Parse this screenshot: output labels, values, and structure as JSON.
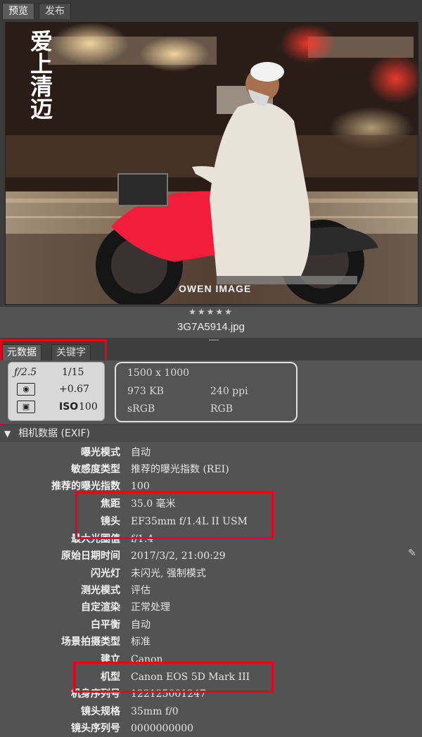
{
  "tabs": [
    "预览",
    "发布"
  ],
  "preview": {
    "watermark_chinese": "爱上清迈",
    "watermark_logo": "OWEN IMAGE",
    "rating": "★★★★★",
    "filename": "3G7A5914.jpg"
  },
  "meta_tabs": [
    "元数据",
    "关键字"
  ],
  "camera": {
    "aperture": "ƒ/2.5",
    "shutter": "1/15",
    "exposure_comp": "+0.67",
    "iso_label": "ISO",
    "iso": "100"
  },
  "file": {
    "dimensions": "1500 x 1000",
    "size": "973 KB",
    "resolution": "240 ppi",
    "color_profile": "sRGB",
    "color_mode": "RGB"
  },
  "section_title": "相机数据 (EXIF)",
  "exif": [
    {
      "key": "曝光模式",
      "value": "自动"
    },
    {
      "key": "敏感度类型",
      "value": "推荐的曝光指数 (REI)"
    },
    {
      "key": "推荐的曝光指数",
      "value": "100"
    },
    {
      "key": "焦距",
      "value": "35.0 毫米"
    },
    {
      "key": "镜头",
      "value": "EF35mm f/1.4L II USM"
    },
    {
      "key": "最大光圈值",
      "value": "f/1.4"
    },
    {
      "key": "原始日期时间",
      "value": "2017/3/2, 21:00:29"
    },
    {
      "key": "闪光灯",
      "value": "未闪光, 强制模式"
    },
    {
      "key": "测光模式",
      "value": "评估"
    },
    {
      "key": "自定渲染",
      "value": "正常处理"
    },
    {
      "key": "白平衡",
      "value": "自动"
    },
    {
      "key": "场景拍摄类型",
      "value": "标准"
    },
    {
      "key": "建立",
      "value": "Canon"
    },
    {
      "key": "机型",
      "value": "Canon EOS 5D Mark III"
    },
    {
      "key": "机身序列号",
      "value": "122125001247"
    },
    {
      "key": "镜头规格",
      "value": "35mm f/0"
    },
    {
      "key": "镜头序列号",
      "value": "0000000000"
    }
  ],
  "colors": {
    "highlight": "#e8001c",
    "panel": "#535353"
  }
}
